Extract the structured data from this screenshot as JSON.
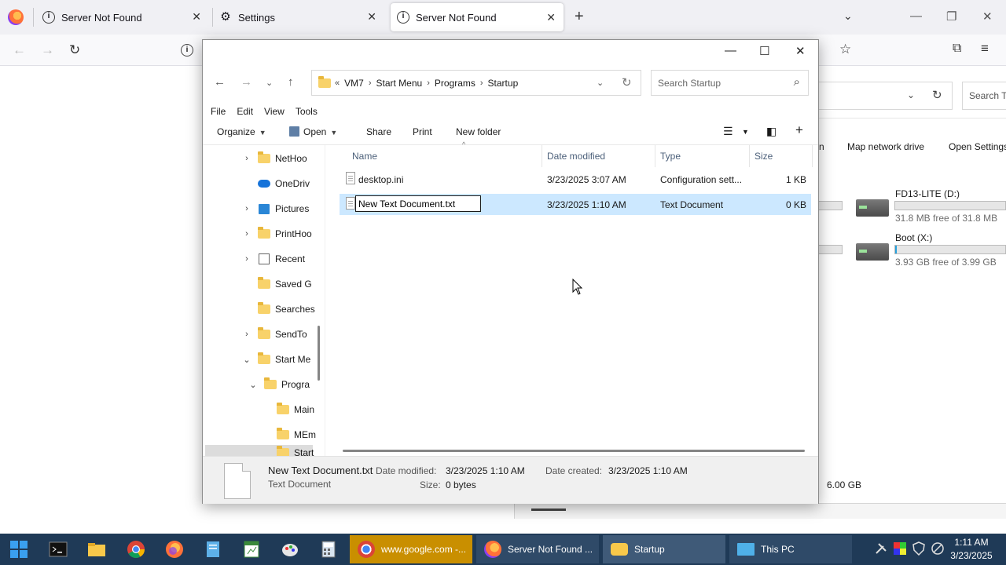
{
  "browser": {
    "tabs": [
      {
        "title": "Server Not Found"
      },
      {
        "title": "Settings"
      },
      {
        "title": "Server Not Found"
      }
    ]
  },
  "explorer": {
    "address": {
      "overflow": "«",
      "crumbs": [
        "VM7",
        "Start Menu",
        "Programs",
        "Startup"
      ]
    },
    "search_placeholder": "Search Startup",
    "menu": [
      "File",
      "Edit",
      "View",
      "Tools"
    ],
    "toolbar": {
      "organize": "Organize",
      "open": "Open",
      "share": "Share",
      "print": "Print",
      "new_folder": "New folder"
    },
    "nav_items": [
      {
        "label": "NetHoo",
        "expander": "right",
        "icon": "folder"
      },
      {
        "label": "OneDriv",
        "expander": "none",
        "icon": "cloud"
      },
      {
        "label": "Pictures",
        "expander": "right",
        "icon": "pictures"
      },
      {
        "label": "PrintHoo",
        "expander": "right",
        "icon": "folder"
      },
      {
        "label": "Recent",
        "expander": "right",
        "icon": "recent"
      },
      {
        "label": "Saved G",
        "expander": "none",
        "icon": "folder"
      },
      {
        "label": "Searches",
        "expander": "none",
        "icon": "folder"
      },
      {
        "label": "SendTo",
        "expander": "right",
        "icon": "folder"
      },
      {
        "label": "Start Me",
        "expander": "down",
        "icon": "folder"
      },
      {
        "label": "Progra",
        "expander": "down",
        "icon": "folder"
      },
      {
        "label": "Main",
        "expander": "none",
        "icon": "folder"
      },
      {
        "label": "MEm",
        "expander": "none",
        "icon": "folder"
      },
      {
        "label": "Start",
        "expander": "none",
        "icon": "folder"
      }
    ],
    "columns": {
      "name": "Name",
      "date": "Date modified",
      "type": "Type",
      "size": "Size"
    },
    "files": [
      {
        "name": "desktop.ini",
        "date": "3/23/2025 3:07 AM",
        "type": "Configuration sett...",
        "size": "1 KB",
        "selected": false
      },
      {
        "name": "New Text Document.txt",
        "date": "3/23/2025 1:10 AM",
        "type": "Text Document",
        "size": "0 KB",
        "selected": true
      }
    ],
    "details": {
      "name": "New Text Document.txt",
      "type": "Text Document",
      "date_modified_label": "Date modified:",
      "date_modified": "3/23/2025 1:10 AM",
      "date_created_label": "Date created:",
      "date_created": "3/23/2025 1:10 AM",
      "size_label": "Size:",
      "size": "0 bytes"
    }
  },
  "background_window": {
    "search": "Search Th",
    "commands": {
      "partial": "n",
      "map_drive": "Map network drive",
      "open_settings": "Open Settings"
    },
    "drives": [
      {
        "name": "FD13-LITE (D:)",
        "free": "31.8 MB free of 31.8 MB",
        "used_fraction": 0.0
      },
      {
        "name": "Boot (X:)",
        "free": "3.93 GB free of 3.99 GB",
        "used_fraction": 0.015
      }
    ],
    "size_text": "6.00 GB"
  },
  "taskbar": {
    "apps": [
      {
        "label": "www.google.com -...",
        "color": "#c98f00"
      },
      {
        "label": "Server Not Found ...",
        "color": "#2f4a68"
      },
      {
        "label": "Startup",
        "color": "#3f5a78"
      },
      {
        "label": "This PC",
        "color": "#2f4a68"
      }
    ],
    "clock": {
      "time": "1:11 AM",
      "date": "3/23/2025"
    }
  },
  "colors": {
    "selection": "#cce8ff",
    "taskbar": "#1f3a57",
    "accent": "#26a0da"
  }
}
